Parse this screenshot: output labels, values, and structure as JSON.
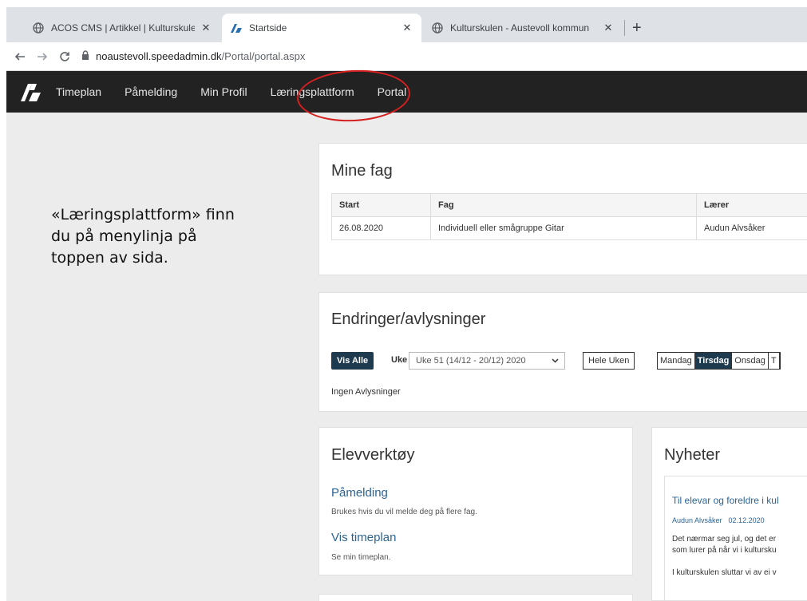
{
  "browser": {
    "tabs": [
      {
        "title": "ACOS CMS | Artikkel | Kulturskule",
        "icon": "globe-icon",
        "active": false
      },
      {
        "title": "Startside",
        "icon": "speedadmin-logo-icon",
        "active": true
      },
      {
        "title": "Kulturskulen - Austevoll kommun",
        "icon": "globe-icon",
        "active": false
      }
    ],
    "close_symbol": "✕",
    "new_tab_symbol": "+",
    "address": {
      "host": "noaustevoll.speedadmin.dk",
      "path": "/Portal/portal.aspx"
    }
  },
  "site_nav": {
    "items": [
      "Timeplan",
      "Påmelding",
      "Min Profil",
      "Læringsplattform",
      "Portal"
    ],
    "highlight_color": "#d62020"
  },
  "callout": {
    "lines": [
      "«Læringsplattform» finn",
      "du på menylinja på",
      "toppen av sida."
    ]
  },
  "mine_fag": {
    "title": "Mine fag",
    "columns": [
      "Start",
      "Fag",
      "Lærer"
    ],
    "rows": [
      [
        "26.08.2020",
        "Individuell eller smågruppe Gitar",
        "Audun Alvsåker"
      ]
    ]
  },
  "endringer": {
    "title": "Endringer/avlysninger",
    "vis_alle": "Vis Alle",
    "uke_label": "Uke",
    "week_value": "Uke 51 (14/12 - 20/12) 2020",
    "hele_uken": "Hele Uken",
    "days": [
      "Mandag",
      "Tirsdag",
      "Onsdag",
      "T"
    ],
    "selected_day": "Tirsdag",
    "empty_text": "Ingen Avlysninger"
  },
  "elevverktoy": {
    "title": "Elevverktøy",
    "links": [
      {
        "label": "Påmelding",
        "desc": "Brukes hvis du vil melde deg på flere fag."
      },
      {
        "label": "Vis timeplan",
        "desc": "Se min timeplan."
      }
    ]
  },
  "nyheter": {
    "title": "Nyheter",
    "item": {
      "title": "Til elevar og foreldre i kul",
      "author": "Audun Alvsåker",
      "date": "02.12.2020",
      "lines": [
        "Det nærmar seg jul, og det er",
        "som lurer på når vi i kultursku",
        "",
        "I kulturskulen sluttar vi av ei v"
      ]
    }
  },
  "colors": {
    "nav_background": "#222222",
    "accent_dark": "#1d3a4f",
    "link": "#2a6496",
    "page_background": "#ececec"
  }
}
